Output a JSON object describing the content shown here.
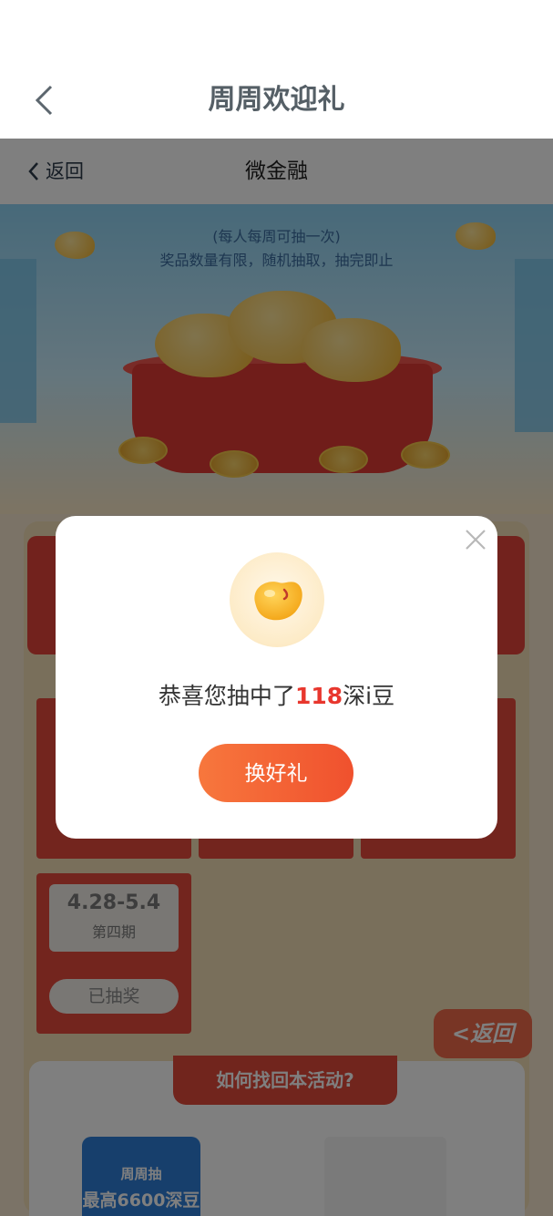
{
  "titlebar": {
    "title": "周周欢迎礼"
  },
  "subbar": {
    "back_label": "返回",
    "title": "微金融"
  },
  "hero": {
    "note_line1": "(每人每周可抽一次)",
    "note_line2": "奖品数量有限，随机抽取，抽完即止"
  },
  "tickets": [
    {
      "date": "4.28-5.4",
      "period": "第四期",
      "status": "已抽奖"
    }
  ],
  "float_button": {
    "label": "<返回"
  },
  "how_to": {
    "banner": "如何找回本活动?"
  },
  "promo": {
    "line1": "周周抽",
    "line2": "最高6600深豆"
  },
  "modal": {
    "message_prefix": "恭喜您抽中了",
    "amount": "118",
    "message_suffix": "深i豆",
    "cta_label": "换好礼",
    "close_icon": "close-icon",
    "reward_icon": "bean-icon"
  },
  "colors": {
    "accent": "#f0512e",
    "highlight": "#e8372e",
    "title_text": "#555f66"
  }
}
